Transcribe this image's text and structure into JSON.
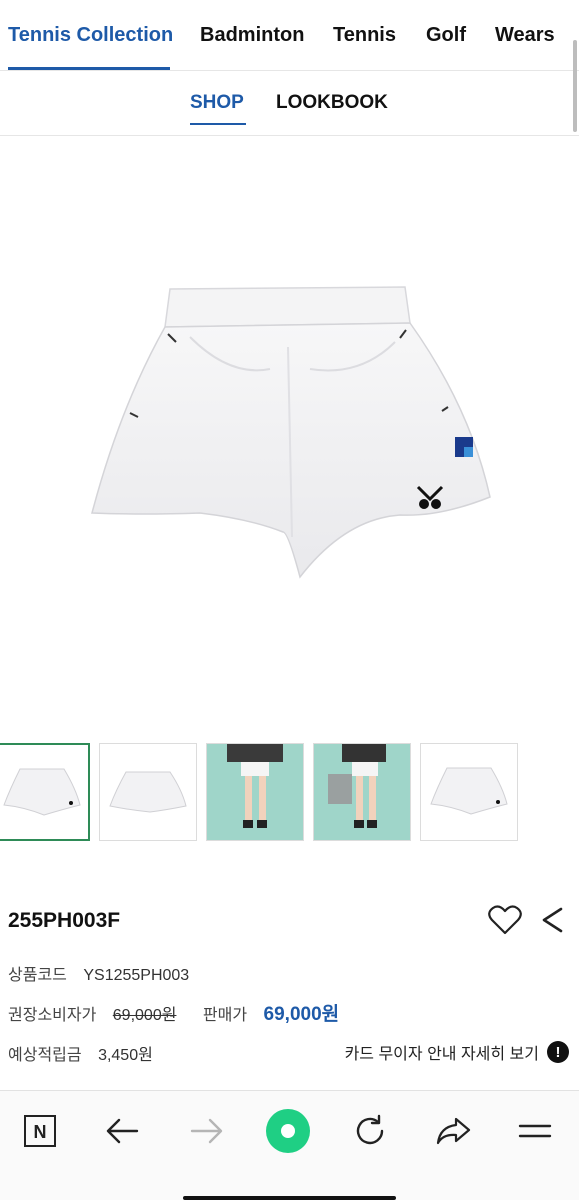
{
  "category_tabs": [
    {
      "label": "Tennis Collection",
      "active": true
    },
    {
      "label": "Badminton",
      "active": false
    },
    {
      "label": "Tennis",
      "active": false
    },
    {
      "label": "Golf",
      "active": false
    },
    {
      "label": "Wears",
      "active": false
    }
  ],
  "sub_tabs": [
    {
      "label": "SHOP",
      "active": true
    },
    {
      "label": "LOOKBOOK",
      "active": false
    }
  ],
  "main_image": {
    "subject": "white-shorts"
  },
  "thumbnails": [
    {
      "subject": "shorts-front",
      "selected": true
    },
    {
      "subject": "shorts-back",
      "selected": false
    },
    {
      "subject": "model-front",
      "selected": false
    },
    {
      "subject": "model-with-bag",
      "selected": false
    },
    {
      "subject": "shorts-front-alt",
      "selected": false
    }
  ],
  "product": {
    "name": "255PH003F",
    "code_label": "상품코드",
    "code_value": "YS1255PH003",
    "msrp_label": "권장소비자가",
    "msrp_value": "69,000원",
    "sale_label": "판매가",
    "sale_value": "69,000원",
    "points_label": "예상적립금",
    "points_value": "3,450원",
    "card_info": "카드 무이자 안내 자세히 보기",
    "card_info_icon": "!"
  },
  "actions": {
    "wishlist_icon": "heart-outline-icon",
    "share_icon": "share-icon"
  },
  "browser_bar": {
    "items": [
      "naver-n-icon",
      "back-arrow-icon",
      "forward-arrow-icon",
      "green-dot-icon",
      "reload-icon",
      "share-arrow-icon",
      "menu-icon"
    ],
    "n_label": "N"
  },
  "colors": {
    "accent": "#1e5aa8",
    "green": "#03c75a",
    "thumb_selected_border": "#2e8b57"
  }
}
